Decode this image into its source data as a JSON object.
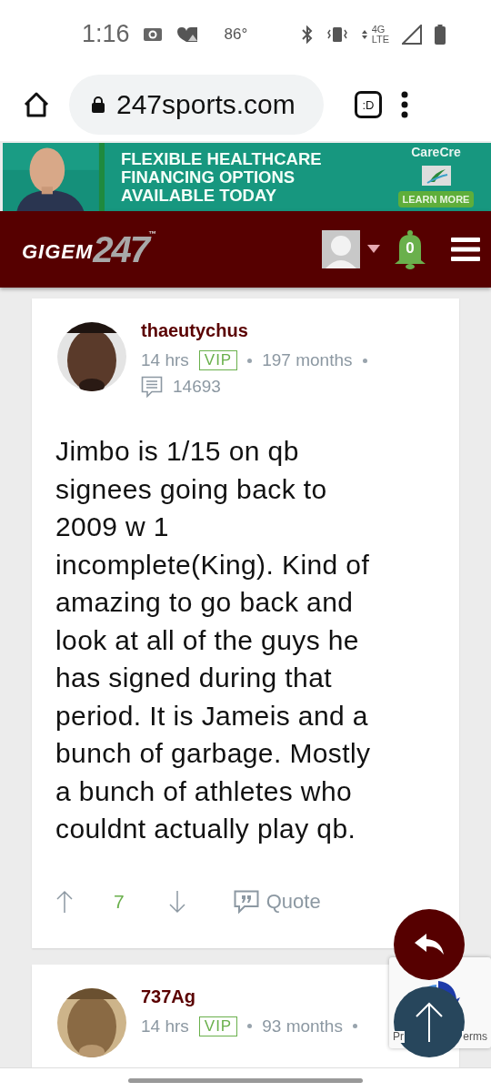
{
  "status_bar": {
    "time": "1:16",
    "temperature": "86°",
    "network_top": "4G",
    "network_bottom": "LTE"
  },
  "browser": {
    "url": "247sports.com",
    "tab_switcher": ":D"
  },
  "ad": {
    "headline": [
      "FLEXIBLE HEALTHCARE",
      "FINANCING OPTIONS",
      "AVAILABLE TODAY"
    ],
    "brand": "CareCre",
    "button": "LEARN MORE"
  },
  "site_header": {
    "logo_main": "GIGEM",
    "logo_number": "247",
    "trademark": "™",
    "notification_count": "0"
  },
  "posts": [
    {
      "author": "thaeutychus",
      "time": "14 hrs",
      "badge": "VIP",
      "tenure": "197 months",
      "post_count": "14693",
      "body": "Jimbo is 1/15 on qb signees going back to 2009 w 1 incomplete(King). Kind of amazing to go back and look at all of the guys he has signed during that period. It is Jameis and a bunch of garbage. Mostly a bunch of athletes who couldnt actually play qb.",
      "votes": "7",
      "quote": "Quote"
    },
    {
      "author": "737Ag",
      "time": "14 hrs",
      "badge": "VIP",
      "tenure": "93 months"
    }
  ],
  "recaptcha": {
    "left_text": "Pr",
    "right_text": "erms"
  }
}
